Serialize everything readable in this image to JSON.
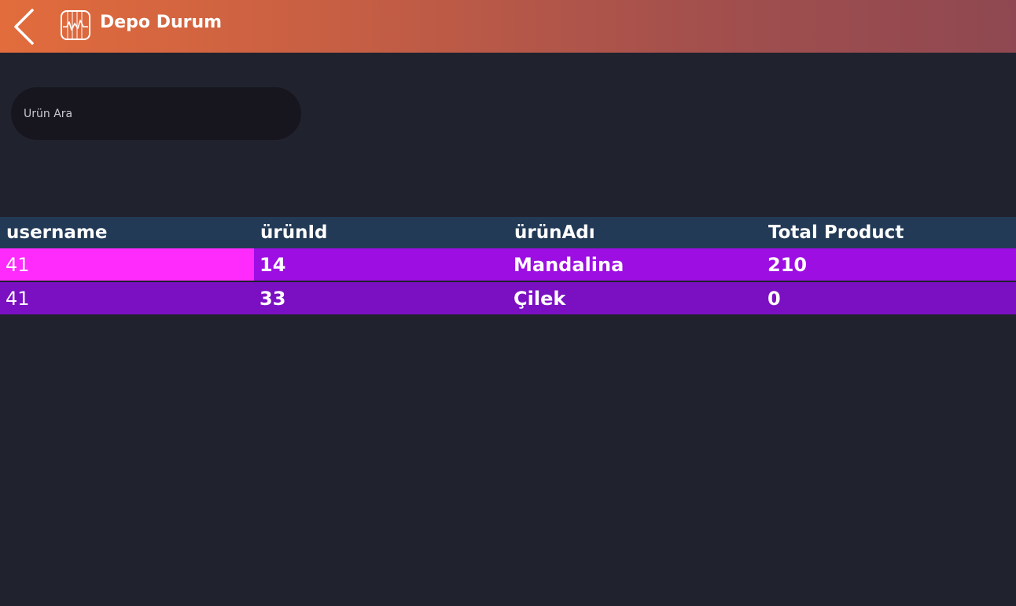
{
  "header": {
    "title": "Depo Durum",
    "back_icon": "chevron-left-icon",
    "app_icon": "chart-icon"
  },
  "search": {
    "placeholder": "Ürün Ara",
    "value": ""
  },
  "table": {
    "columns": [
      "username",
      "ürünId",
      "ürünAdı",
      "Total Product"
    ],
    "rows": [
      [
        "41",
        "14",
        "Mandalina",
        "210"
      ],
      [
        "41",
        "33",
        "Çilek",
        "0"
      ]
    ],
    "colors": {
      "header_bg": "#223a56",
      "row1_bg": "#9d0ee2",
      "row1_selected_cell_bg": "#ff2afc",
      "row2_bg": "#7b10c2"
    }
  },
  "colors": {
    "page_bg": "#20222e",
    "header_gradient_start": "#e26c3c",
    "header_gradient_end": "#8f4851",
    "search_bg": "#17161f"
  }
}
